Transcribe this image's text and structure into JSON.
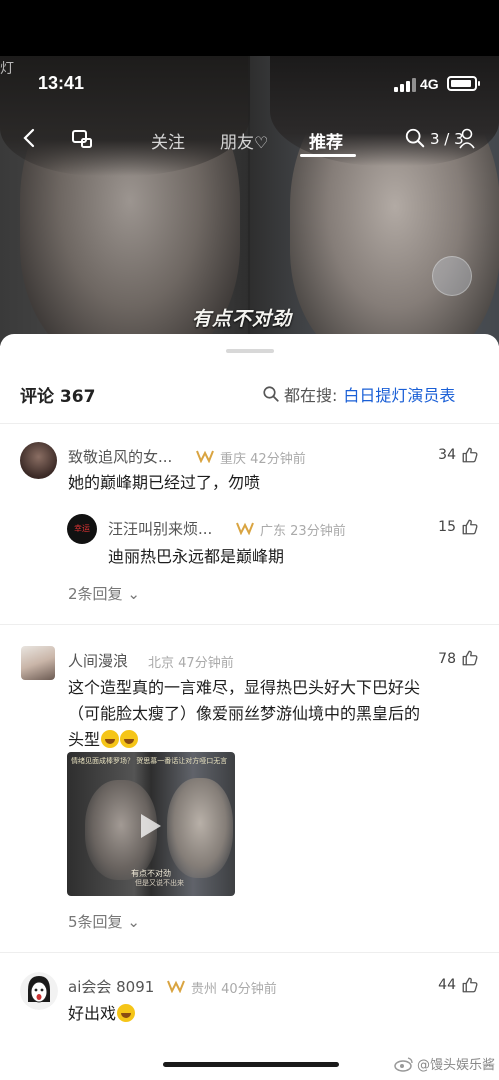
{
  "status_bar": {
    "time": "13:41",
    "network": "4G"
  },
  "video": {
    "subtitle": "有点不对劲",
    "corner_watermark": "灯"
  },
  "nav": {
    "tabs": [
      {
        "label": "关注"
      },
      {
        "label": "朋友"
      },
      {
        "label": "推荐",
        "active": true
      }
    ],
    "page_counter": "3 / 3"
  },
  "comments_panel": {
    "title": "评论 367",
    "search_label": "都在搜:",
    "search_term": "白日提灯演员表"
  },
  "comments": [
    {
      "username": "致敬追风的女...",
      "location": "重庆",
      "time_ago": "42分钟前",
      "likes": "34",
      "text": "她的巅峰期已经过了，勿喷",
      "replies_label": "2条回复",
      "reply": {
        "username": "汪汪叫别来烦...",
        "avatar_text": "幸运",
        "location": "广东",
        "time_ago": "23分钟前",
        "likes": "15",
        "text": "迪丽热巴永远都是巅峰期"
      }
    },
    {
      "username": "人间漫浪",
      "location": "北京",
      "time_ago": "47分钟前",
      "likes": "78",
      "text_line1": "这个造型真的一言难尽，显得热巴头好大下巴好尖",
      "text_line2": "（可能脸太瘦了）像爱丽丝梦游仙境中的黑皇后的",
      "text_line3": "头型",
      "image": {
        "caption_top": "情绪见面成棒罗场？ 贺思慕一番话让对方哑口无言",
        "subtitle_1": "有点不对劲",
        "subtitle_2": "但是又说不出来"
      },
      "replies_label": "5条回复"
    },
    {
      "username": "ai会会 8091",
      "location": "贵州",
      "time_ago": "40分钟前",
      "likes": "44",
      "text": "好出戏"
    }
  ],
  "footer": {
    "watermark": "@馒头娱乐酱"
  }
}
